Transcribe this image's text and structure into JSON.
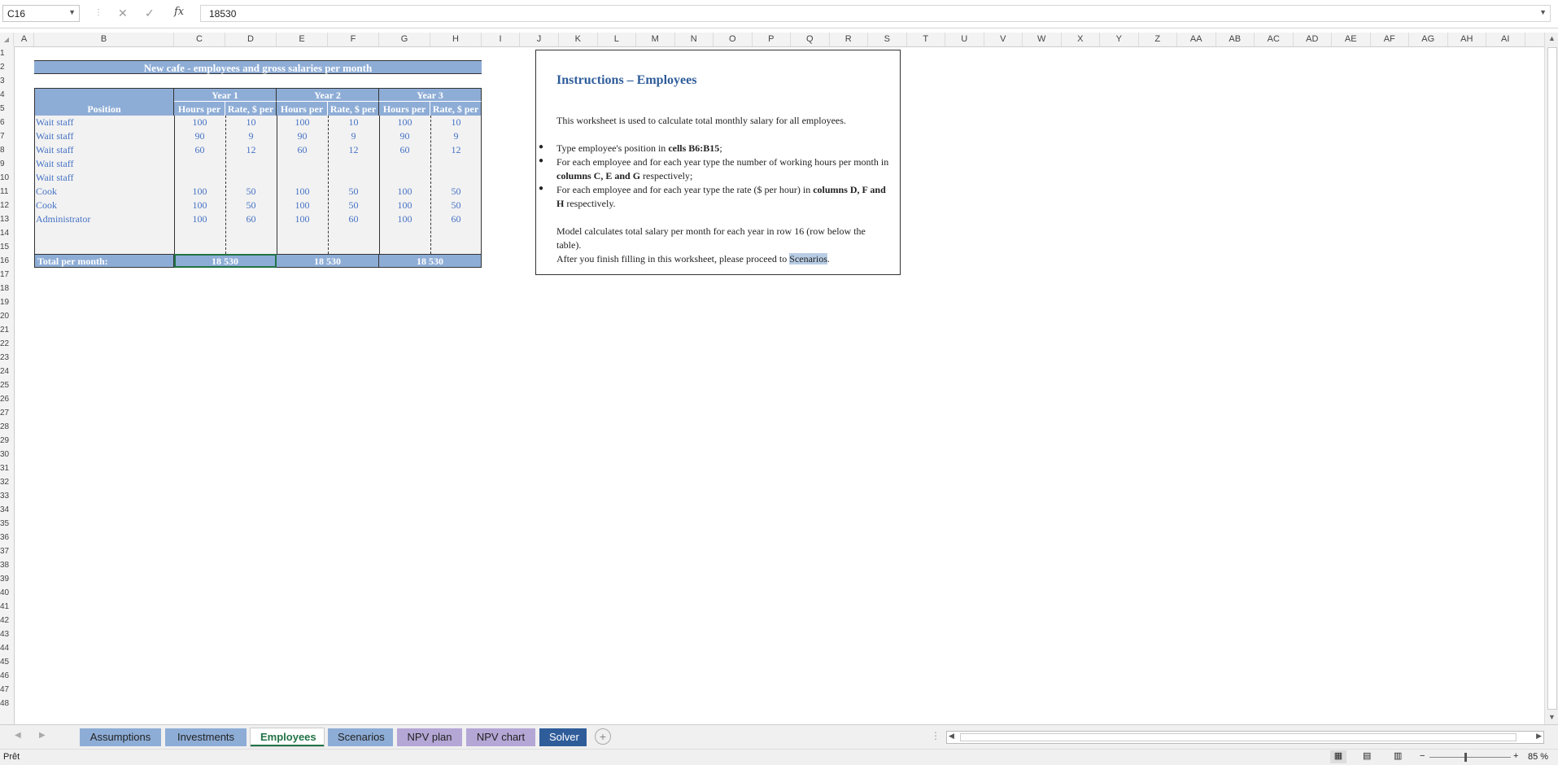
{
  "formula_bar": {
    "name_box": "C16",
    "formula": "18530"
  },
  "columns": [
    "A",
    "B",
    "C",
    "D",
    "E",
    "F",
    "G",
    "H",
    "I",
    "J",
    "K",
    "L",
    "M",
    "N",
    "O",
    "P",
    "Q",
    "R",
    "S",
    "T",
    "U",
    "V",
    "W",
    "X",
    "Y",
    "Z",
    "AA",
    "AB",
    "AC",
    "AD",
    "AE",
    "AF",
    "AG",
    "AH",
    "AI"
  ],
  "rows": [
    "1",
    "2",
    "3",
    "4",
    "5",
    "6",
    "7",
    "8",
    "9",
    "10",
    "11",
    "12",
    "13",
    "14",
    "15",
    "16",
    "17",
    "18",
    "19",
    "20",
    "21",
    "22",
    "23",
    "24",
    "25",
    "26",
    "27",
    "28",
    "29",
    "30",
    "31",
    "32",
    "33",
    "34",
    "35",
    "36",
    "37",
    "38",
    "39",
    "40",
    "41",
    "42",
    "43",
    "44",
    "45",
    "46",
    "47",
    "48"
  ],
  "sheet": {
    "title": "New cafe - employees and gross salaries per month",
    "position_header": "Position",
    "years": [
      "Year 1",
      "Year 2",
      "Year 3"
    ],
    "hours_header": "Hours per month",
    "rate_header": "Rate, $ per hour",
    "employees": [
      {
        "position": "Wait staff",
        "values": [
          "100",
          "10",
          "100",
          "10",
          "100",
          "10"
        ]
      },
      {
        "position": "Wait staff",
        "values": [
          "90",
          "9",
          "90",
          "9",
          "90",
          "9"
        ]
      },
      {
        "position": "Wait staff",
        "values": [
          "60",
          "12",
          "60",
          "12",
          "60",
          "12"
        ]
      },
      {
        "position": "Wait staff",
        "values": [
          "",
          "",
          "",
          "",
          "",
          ""
        ]
      },
      {
        "position": "Wait staff",
        "values": [
          "",
          "",
          "",
          "",
          "",
          ""
        ]
      },
      {
        "position": "Cook",
        "values": [
          "100",
          "50",
          "100",
          "50",
          "100",
          "50"
        ]
      },
      {
        "position": "Cook",
        "values": [
          "100",
          "50",
          "100",
          "50",
          "100",
          "50"
        ]
      },
      {
        "position": "Administrator",
        "values": [
          "100",
          "60",
          "100",
          "60",
          "100",
          "60"
        ]
      },
      {
        "position": "",
        "values": [
          "",
          "",
          "",
          "",
          "",
          ""
        ]
      },
      {
        "position": "",
        "values": [
          "",
          "",
          "",
          "",
          "",
          ""
        ]
      }
    ],
    "total_label": "Total per month:",
    "totals": [
      "18 530",
      "18 530",
      "18 530"
    ]
  },
  "instructions": {
    "title": "Instructions – Employees",
    "intro": "This worksheet is used to calculate total monthly salary for all employees.",
    "b1_pre": "Type employee's position in ",
    "b1_bold": "cells B6:B15",
    "b1_post": ";",
    "b2_pre": "For each employee and for each year type the number of working hours per month in ",
    "b2_bold": "columns C, E and G",
    "b2_post": " respectively;",
    "b3_pre": "For each employee and for each year type the rate ($ per hour) in ",
    "b3_bold": "columns D, F and H",
    "b3_post": " respectively.",
    "model_text": "Model calculates total salary per month for each year in row 16 (row below the table).",
    "finish_pre": "After you finish filling in this worksheet, please proceed to ",
    "finish_link": "Scenarios",
    "finish_post": "."
  },
  "tabs": [
    {
      "label": "Assumptions"
    },
    {
      "label": "Investments"
    },
    {
      "label": "Employees"
    },
    {
      "label": "Scenarios"
    },
    {
      "label": "NPV plan"
    },
    {
      "label": "NPV chart"
    },
    {
      "label": "Solver"
    }
  ],
  "tab_colors": [
    "#8eadd6",
    "#8eadd6",
    "#ffffff",
    "#8eadd6",
    "#b4a7d6",
    "#b4a7d6",
    "#2f5d9a"
  ],
  "status": {
    "ready": "Prêt",
    "zoom": "85 %"
  }
}
